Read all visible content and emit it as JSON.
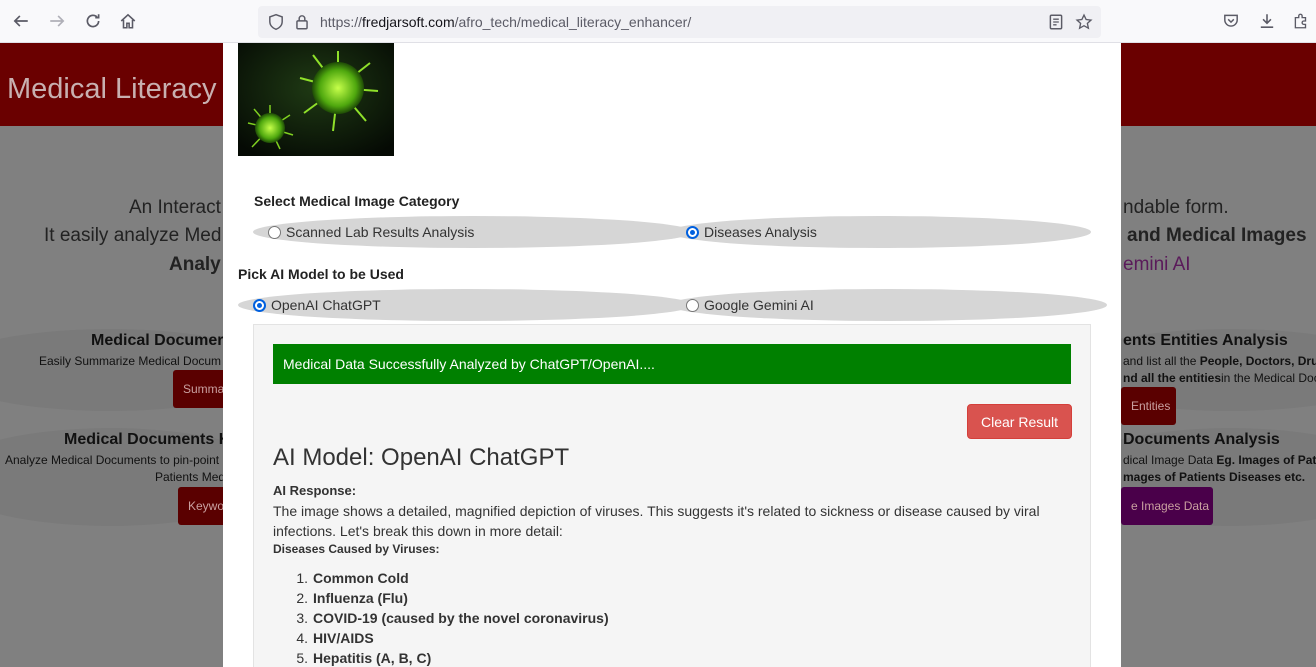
{
  "browser": {
    "url_prefix": "https://",
    "url_host": "fredjarsoft.com",
    "url_path": "/afro_tech/medical_literacy_enhancer/"
  },
  "background": {
    "title": "Medical Literacy",
    "intro_line1": "An Interact",
    "intro_line1_right": "ndable form.",
    "intro_line2": "It easily analyze Med",
    "intro_line2_right": "and Medical Images",
    "intro_line3": "Analy",
    "intro_line3_right": "emini AI",
    "card1_title": "Medical Documer",
    "card1_sub": "Easily Summarize Medical Docum",
    "card1_button": "Summa",
    "card2_title": "Medical Documents K",
    "card2_sub1": "Analyze Medical Documents to pin-point",
    "card2_sub2": "Patients Med",
    "card2_button": "Keywo",
    "card3_title": "ents Entities Analysis",
    "card3_sub1_normal": "and list all the ",
    "card3_sub1_bold": "People, Doctors, Drug",
    "card3_sub2_bold": "nd all the entities",
    "card3_sub2_normal": "in the Medical Doc",
    "card3_button": "Entities",
    "card4_title": "Documents Analysis",
    "card4_sub1_normal": "dical Image Data ",
    "card4_sub1_bold": "Eg. Images of Pat",
    "card4_sub2_bold": "mages of Patients Diseases etc.",
    "card4_button": "e Images Data"
  },
  "modal": {
    "category_label": "Select Medical Image Category",
    "category_options": [
      "Scanned Lab Results Analysis",
      "Diseases Analysis"
    ],
    "model_label": "Pick AI Model to be Used",
    "model_options": [
      "OpenAI ChatGPT",
      "Google Gemini AI"
    ],
    "success_message": "Medical Data Successfully Analyzed by ChatGPT/OpenAI....",
    "clear_button": "Clear Result",
    "model_heading": "AI Model: OpenAI ChatGPT",
    "response_label": "AI Response:",
    "response_text": "The image shows a detailed, magnified depiction of viruses. This suggests it's related to sickness or disease caused by viral infections. Let's break this down in more detail:",
    "response_subheading": "Diseases Caused by Viruses:",
    "diseases": [
      {
        "num": "1.",
        "name": "Common Cold"
      },
      {
        "num": "2.",
        "name": "Influenza (Flu)"
      },
      {
        "num": "3.",
        "name": "COVID-19 (caused by the novel coronavirus)"
      },
      {
        "num": "4.",
        "name": "HIV/AIDS"
      },
      {
        "num": "5.",
        "name": "Hepatitis (A, B, C)"
      }
    ]
  },
  "colors": {
    "header_red": "#6a0000",
    "success_green": "#008000",
    "danger_red": "#d9534f"
  },
  "icons": [
    "back-icon",
    "forward-icon",
    "reload-icon",
    "home-icon",
    "shield-icon",
    "lock-icon",
    "reader-view-icon",
    "star-icon",
    "pocket-icon",
    "download-icon",
    "extensions-icon"
  ]
}
